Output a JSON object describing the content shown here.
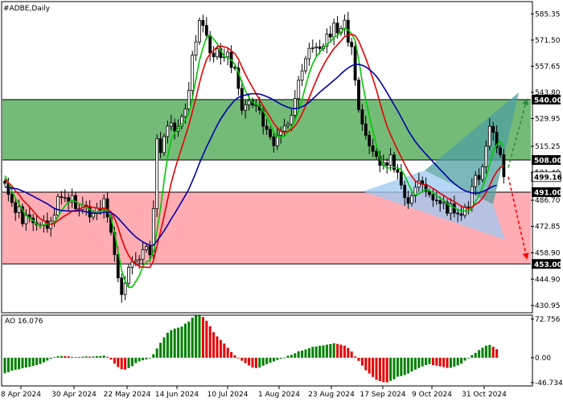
{
  "chart_data": {
    "type": "candlestick",
    "title": "#ADBE,Daily",
    "y_ticks": [
      585.35,
      571.5,
      557.65,
      543.8,
      529.95,
      515.25,
      501.4,
      486.7,
      472.85,
      458.9,
      444.9,
      430.95
    ],
    "x_ticks": [
      "8 Apr 2024",
      "30 Apr 2024",
      "22 May 2024",
      "14 Jun 2024",
      "10 Jul 2024",
      "1 Aug 2024",
      "23 Aug 2024",
      "17 Sep 2024",
      "9 Oct 2024",
      "31 Oct 2024"
    ],
    "ylim": [
      428.0,
      591.0
    ],
    "levels": [
      {
        "value": 540.0,
        "label": "540.00",
        "color": "#000000",
        "text_color": "#ffffff"
      },
      {
        "value": 508.0,
        "label": "508.00",
        "color": "#000000",
        "text_color": "#ffffff"
      },
      {
        "value": 491.0,
        "label": "491.00",
        "color": "#000000",
        "text_color": "#ffffff"
      },
      {
        "value": 453.0,
        "label": "453.00",
        "color": "#000000",
        "text_color": "#ffffff"
      }
    ],
    "current_price": {
      "value": 499.16,
      "label": "499.16"
    },
    "zones": [
      {
        "from": 508.0,
        "to": 540.0,
        "color": "#5daf60"
      },
      {
        "from": 453.0,
        "to": 491.0,
        "color": "#ff9ea6"
      }
    ],
    "closes": [
      495.7,
      489.8,
      485.5,
      480.2,
      483.3,
      474.3,
      479.0,
      477.3,
      474.8,
      473.6,
      473.3,
      475.8,
      471.8,
      475.6,
      478.9,
      488.6,
      488.1,
      488.1,
      485.7,
      489.2,
      482.2,
      481.8,
      484.1,
      483.0,
      477.8,
      479.9,
      482.4,
      481.4,
      487.5,
      477.8,
      469.7,
      457.9,
      445.6,
      436.8,
      442.8,
      451.2,
      454.0,
      454.8,
      455.4,
      460.5,
      462.2,
      457.8,
      482.2,
      519.3,
      511.9,
      520.4,
      525.9,
      527.6,
      523.3,
      525.8,
      531.0,
      535.0,
      544.9,
      563.5,
      570.5,
      581.9,
      579.2,
      574.0,
      564.6,
      562.6,
      566.9,
      562.2,
      562.6,
      565.1,
      557.0,
      556.8,
      545.9,
      534.3,
      537.2,
      539.5,
      537.1,
      537.0,
      534.4,
      525.9,
      524.2,
      520.3,
      515.6,
      521.1,
      523.3,
      526.1,
      527.0,
      531.7,
      540.6,
      550.2,
      555.2,
      561.6,
      567.1,
      567.4,
      567.9,
      567.0,
      568.2,
      574.7,
      573.1,
      580.5,
      575.3,
      577.6,
      582.0,
      570.3,
      568.0,
      550.3,
      534.6,
      527.1,
      521.1,
      515.5,
      512.6,
      510.0,
      505.2,
      506.5,
      505.2,
      510.7,
      502.9,
      501.5,
      494.7,
      488.1,
      485.1,
      489.1,
      493.6,
      497.0,
      495.1,
      491.4,
      489.7,
      486.8,
      486.5,
      485.0,
      485.7,
      479.8,
      484.8,
      479.9,
      479.5,
      478.7,
      483.2,
      482.9,
      493.9,
      499.9,
      497.7,
      504.4,
      515.3,
      525.8,
      522.7,
      514.5,
      510.8,
      499.2
    ],
    "series": [
      {
        "name": "",
        "color": "#00c800",
        "values": [
          499.7,
          496.1,
          491.7,
          487.8,
          484.9,
          481.6,
          478.5,
          477.4,
          476.0,
          474.1,
          473.0,
          473.7,
          474.1,
          474.1,
          474.8,
          477.9,
          481.1,
          483.7,
          485.7,
          486.6,
          486.0,
          484.9,
          484.0,
          483.1,
          481.8,
          480.7,
          480.6,
          480.8,
          482.0,
          481.2,
          477.6,
          469.6,
          459.8,
          449.7,
          443.9,
          440.5,
          440.8,
          443.6,
          446.8,
          451.6,
          454.2,
          454.9,
          459.3,
          470.4,
          482.4,
          497.0,
          509.4,
          518.5,
          522.4,
          524.7,
          526.9,
          529.3,
          532.8,
          540.6,
          550.8,
          560.8,
          567.3,
          572.8,
          574.1,
          572.0,
          569.6,
          566.2,
          562.7,
          562.2,
          560.9,
          558.8,
          554.5,
          549.2,
          544.5,
          541.1,
          538.7,
          537.6,
          536.6,
          534.1,
          530.9,
          527.5,
          522.5,
          520.3,
          520.1,
          520.6,
          522.6,
          525.3,
          529.0,
          534.0,
          540.0,
          547.2,
          553.9,
          559.0,
          562.6,
          565.1,
          567.3,
          569.4,
          570.4,
          572.9,
          574.1,
          575.6,
          577.7,
          576.9,
          574.8,
          571.2,
          561.2,
          549.3,
          539.9,
          531.2,
          523.5,
          516.0,
          509.0,
          505.3,
          503.9,
          503.8,
          504.2,
          503.8,
          502.9,
          499.8,
          495.6,
          491.6,
          489.5,
          490.0,
          491.5,
          492.2,
          491.8,
          490.6,
          489.3,
          487.8,
          486.8,
          484.9,
          483.6,
          482.8,
          481.8,
          481.0,
          481.1,
          480.8,
          482.7,
          486.1,
          489.1,
          493.6,
          498.9,
          505.6,
          512.8,
          516.0,
          518.0,
          515.3
        ]
      },
      {
        "name": "",
        "color": "#e60000",
        "values": [
          497.8,
          496.1,
          494.2,
          491.7,
          489.8,
          487.0,
          485.1,
          483.2,
          481.0,
          478.8,
          476.9,
          475.9,
          474.6,
          474.0,
          474.4,
          475.9,
          477.3,
          478.5,
          479.6,
          481.0,
          481.3,
          481.9,
          482.8,
          483.7,
          483.4,
          482.9,
          482.7,
          482.1,
          482.6,
          481.9,
          480.6,
          477.3,
          472.3,
          466.2,
          461.3,
          457.4,
          454.6,
          453.0,
          451.7,
          451.3,
          451.3,
          451.1,
          454.6,
          462.7,
          470.1,
          478.3,
          487.0,
          495.7,
          502.6,
          508.8,
          514.6,
          520.4,
          526.5,
          533.6,
          540.8,
          548.8,
          555.7,
          561.2,
          564.2,
          566.1,
          567.8,
          568.4,
          567.9,
          567.4,
          565.8,
          564.3,
          561.4,
          557.3,
          553.3,
          549.7,
          546.5,
          543.1,
          539.9,
          536.7,
          533.6,
          530.6,
          527.4,
          525.0,
          523.2,
          522.7,
          523.2,
          524.2,
          526.0,
          528.8,
          532.4,
          536.6,
          541.0,
          545.6,
          550.1,
          554.4,
          558.0,
          561.4,
          564.2,
          567.0,
          569.0,
          571.1,
          573.3,
          574.2,
          574.5,
          573.9,
          571.0,
          566.5,
          561.8,
          556.7,
          551.1,
          545.1,
          538.3,
          531.9,
          525.9,
          521.4,
          517.3,
          513.3,
          509.6,
          505.8,
          502.2,
          499.3,
          496.9,
          495.8,
          495.3,
          494.9,
          494.1,
          492.9,
          491.8,
          490.3,
          489.3,
          488.0,
          487.0,
          486.0,
          484.8,
          483.6,
          482.9,
          482.3,
          483.1,
          484.5,
          485.7,
          487.9,
          490.8,
          494.4,
          498.6,
          501.8,
          504.1,
          505.2
        ]
      },
      {
        "name": "",
        "color": "#0000aa",
        "values": [
          493.7,
          493.4,
          493.1,
          492.9,
          492.4,
          491.6,
          490.8,
          489.8,
          488.8,
          487.8,
          486.8,
          485.8,
          484.8,
          483.6,
          482.4,
          481.8,
          481.3,
          481.1,
          481.0,
          481.0,
          481.0,
          481.1,
          481.0,
          480.6,
          480.1,
          479.9,
          479.8,
          479.9,
          480.4,
          480.5,
          480.1,
          479.0,
          477.3,
          475.1,
          473.1,
          471.0,
          469.1,
          467.3,
          465.9,
          464.6,
          463.7,
          462.7,
          462.9,
          465.2,
          467.7,
          470.5,
          473.5,
          476.8,
          479.7,
          482.8,
          486.0,
          489.2,
          492.6,
          496.9,
          501.4,
          506.3,
          510.7,
          514.9,
          518.7,
          522.6,
          526.3,
          529.7,
          532.5,
          535.3,
          537.5,
          539.7,
          541.1,
          541.9,
          542.4,
          542.9,
          543.1,
          543.1,
          542.9,
          542.3,
          541.6,
          540.8,
          539.7,
          538.6,
          537.5,
          536.7,
          535.9,
          535.3,
          535.2,
          535.5,
          536.2,
          537.2,
          538.6,
          540.3,
          542.1,
          543.9,
          545.5,
          547.0,
          548.6,
          550.2,
          551.8,
          553.6,
          555.3,
          556.7,
          557.9,
          558.6,
          558.6,
          558.2,
          557.3,
          555.9,
          554.3,
          552.3,
          549.7,
          546.8,
          543.7,
          540.5,
          537.2,
          534.0,
          530.6,
          527.1,
          523.6,
          520.6,
          517.8,
          515.3,
          513.2,
          511.1,
          509.1,
          507.0,
          505.0,
          503.0,
          501.1,
          499.1,
          497.2,
          495.6,
          494.1,
          492.8,
          491.7,
          491.1,
          490.6,
          490.4,
          490.6,
          491.3,
          492.0,
          493.1,
          494.1,
          494.6
        ]
      }
    ],
    "projections": [
      {
        "direction": "up",
        "color": "#2e8b3c",
        "from": 504.0,
        "to": 540.0
      },
      {
        "direction": "down",
        "color": "#ff0000",
        "from": 499.16,
        "to": 456.0
      }
    ],
    "oscillator": {
      "name": "AO 16.076",
      "y_ticks": [
        72.756,
        0.0,
        -46.734
      ],
      "ylim": [
        -50.0,
        77.0
      ],
      "values": [
        -29.2,
        -27.1,
        -24.3,
        -22.7,
        -21.8,
        -19.9,
        -18.5,
        -17.0,
        -15.4,
        -13.7,
        -11.8,
        -8.7,
        -5.4,
        -1.9,
        1.2,
        2.7,
        3.2,
        3.1,
        2.7,
        1.5,
        1.0,
        1.4,
        1.9,
        2.4,
        2.0,
        2.2,
        3.0,
        3.2,
        4.0,
        1.7,
        -3.5,
        -11.0,
        -17.6,
        -21.7,
        -22.3,
        -19.5,
        -15.9,
        -10.2,
        -6.7,
        -4.8,
        -3.2,
        -0.2,
        6.6,
        17.4,
        28.1,
        38.2,
        47.1,
        51.8,
        54.7,
        56.4,
        58.6,
        64.0,
        68.0,
        75.5,
        79.2,
        80.2,
        76.6,
        69.5,
        59.3,
        48.0,
        40.1,
        33.1,
        26.6,
        18.7,
        10.7,
        4.4,
        -0.9,
        -5.6,
        -10.0,
        -14.5,
        -18.4,
        -19.5,
        -18.4,
        -15.0,
        -12.2,
        -9.4,
        -6.9,
        -4.1,
        -1.8,
        0.2,
        3.8,
        5.3,
        8.4,
        12.0,
        13.4,
        15.7,
        17.8,
        20.5,
        21.0,
        22.5,
        23.3,
        24.6,
        25.7,
        27.2,
        26.0,
        24.6,
        22.7,
        18.3,
        11.6,
        2.4,
        -5.9,
        -14.7,
        -23.6,
        -29.8,
        -36.1,
        -41.5,
        -44.0,
        -46.0,
        -46.4,
        -43.6,
        -40.5,
        -35.6,
        -34.5,
        -32.5,
        -29.7,
        -25.8,
        -22.4,
        -19.4,
        -16.3,
        -13.8,
        -12.1,
        -13.8,
        -14.9,
        -16.3,
        -17.6,
        -19.1,
        -18.9,
        -16.7,
        -14.4,
        -11.3,
        -5.4,
        -0.5,
        4.9,
        9.1,
        14.4,
        18.8,
        22.7,
        24.3,
        20.6,
        16.1
      ]
    }
  }
}
